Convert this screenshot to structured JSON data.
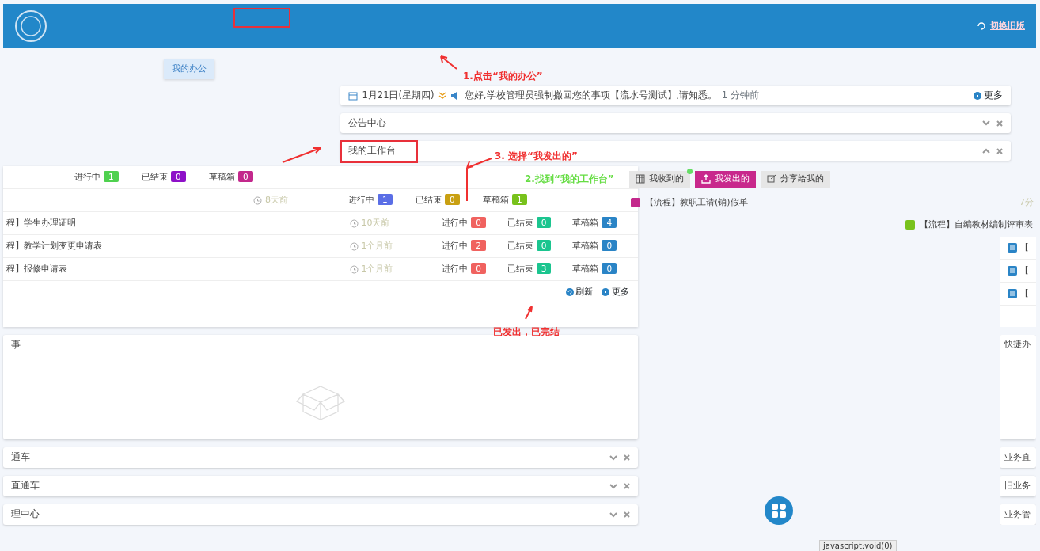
{
  "header": {
    "switch_link": "切换旧版"
  },
  "nav_button": "我的办公",
  "notice": {
    "date": "1月21日(星期四)",
    "message": "您好,学校管理员强制撤回您的事项【流水号测试】,请知悉。",
    "time": "1 分钟前",
    "more": "更多"
  },
  "top_panels": [
    {
      "title": "公告中心",
      "expanded": false
    },
    {
      "title": "我的工作台",
      "expanded": true
    }
  ],
  "workbench": {
    "summary_rows": [
      {
        "time": "",
        "counts": [
          {
            "label": "进行中",
            "value": "1",
            "color": "#4fd14f"
          },
          {
            "label": "已结束",
            "value": "0",
            "color": "#8e10c8"
          },
          {
            "label": "草稿箱",
            "value": "0",
            "color": "#c3288c"
          }
        ]
      },
      {
        "time": "8天前",
        "counts": [
          {
            "label": "进行中",
            "value": "1",
            "color": "#5a6ee6"
          },
          {
            "label": "已结束",
            "value": "0",
            "color": "#c9a012"
          },
          {
            "label": "草稿箱",
            "value": "1",
            "color": "#78c21c"
          }
        ]
      }
    ],
    "rows": [
      {
        "title": "程】学生办理证明",
        "time": "10天前",
        "counts": [
          {
            "label": "进行中",
            "value": "0",
            "color": "#f0625f"
          },
          {
            "label": "已结束",
            "value": "0",
            "color": "#1bc58f"
          },
          {
            "label": "草稿箱",
            "value": "4",
            "color": "#2a84c6"
          }
        ]
      },
      {
        "title": "程】教学计划变更申请表",
        "time": "1个月前",
        "counts": [
          {
            "label": "进行中",
            "value": "2",
            "color": "#f0625f"
          },
          {
            "label": "已结束",
            "value": "0",
            "color": "#1bc58f"
          },
          {
            "label": "草稿箱",
            "value": "0",
            "color": "#2a84c6"
          }
        ]
      },
      {
        "title": "程】报修申请表",
        "time": "1个月前",
        "counts": [
          {
            "label": "进行中",
            "value": "0",
            "color": "#f0625f"
          },
          {
            "label": "已结束",
            "value": "3",
            "color": "#1bc58f"
          },
          {
            "label": "草稿箱",
            "value": "0",
            "color": "#2a84c6"
          }
        ]
      }
    ],
    "footer": [
      {
        "label": "刷新",
        "kind": "refresh"
      },
      {
        "label": "更多",
        "kind": "more"
      }
    ]
  },
  "tabs": [
    {
      "label": "我收到的",
      "selected": false,
      "dot": true
    },
    {
      "label": "我发出的",
      "selected": true,
      "dot": false
    },
    {
      "label": "分享给我的",
      "selected": false,
      "dot": false
    }
  ],
  "tab_items": [
    {
      "title": "【流程】教职工请(销)假单",
      "color": "#c3288c"
    },
    {
      "title": "【流程】自编教材编制评审表",
      "color": "#78c21c"
    }
  ],
  "side_items": [
    {
      "title": "【"
    },
    {
      "title": "【"
    },
    {
      "title": "【"
    }
  ],
  "side_time": "7分",
  "left_panels": [
    {
      "title": "事",
      "kind": "empty"
    },
    {
      "title": "通车",
      "kind": "collapsed"
    },
    {
      "title": "直通车",
      "kind": "collapsed"
    },
    {
      "title": "理中心",
      "kind": "collapsed"
    }
  ],
  "right_panels": [
    {
      "title": "快捷办",
      "kind": "empty"
    },
    {
      "title": "业务直",
      "kind": "collapsed"
    },
    {
      "title": "旧业务",
      "kind": "collapsed"
    },
    {
      "title": "业务管",
      "kind": "collapsed"
    }
  ],
  "status_url": "javascript:void(0)",
  "annotations": [
    {
      "text": "1.点击“我的办公”",
      "color": "#f03030"
    },
    {
      "text": "3. 选择“我发出的”",
      "color": "#f03030"
    },
    {
      "text": "2.找到“我的工作台”",
      "color": "#66dd44"
    },
    {
      "text": "已发出，已完结",
      "color": "#f03030"
    }
  ]
}
